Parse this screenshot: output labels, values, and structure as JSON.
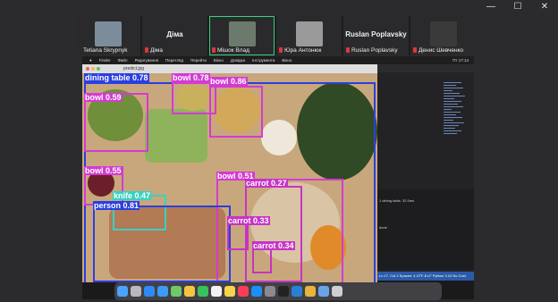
{
  "window_controls": {
    "minimize": "—",
    "maximize": "☐",
    "close": "✕"
  },
  "participants": [
    {
      "name": "Tetiana Skrypnyk",
      "has_video": true,
      "muted": false
    },
    {
      "name": "Діма",
      "has_video": false,
      "muted": true
    },
    {
      "name": "Мішок Влад",
      "has_video": true,
      "muted": true,
      "active_speaker": true
    },
    {
      "name": "Юра Антонюк",
      "has_video": true,
      "muted": true
    },
    {
      "name": "Ruslan Poplavsky",
      "has_video": false,
      "muted": true
    },
    {
      "name": "Денис Шевченко",
      "has_video": true,
      "muted": true
    }
  ],
  "mac_menubar": [
    "Finder",
    "Файл",
    "Редагування",
    "Перегляд",
    "Перейти",
    "Вікно",
    "Довідка",
    "Інструменти",
    "Вікно",
    "Довідка"
  ],
  "mac_status": "Пт 17:14",
  "preview": {
    "filename": "predict.jpg"
  },
  "detections": [
    {
      "label": "dining table 0.78",
      "color": "#2a3fe0"
    },
    {
      "label": "bowl 0.59",
      "color": "#d33bd3"
    },
    {
      "label": "bowl 0.78",
      "color": "#d33bd3"
    },
    {
      "label": "bowl 0.86",
      "color": "#d33bd3"
    },
    {
      "label": "bowl 0.55",
      "color": "#d33bd3"
    },
    {
      "label": "bowl 0.51",
      "color": "#d33bd3"
    },
    {
      "label": "carrot 0.27",
      "color": "#c733c7"
    },
    {
      "label": "knife 0.47",
      "color": "#3ad1c0"
    },
    {
      "label": "person 0.81",
      "color": "#2a3fe0"
    },
    {
      "label": "carrot 0.33",
      "color": "#c733c7"
    },
    {
      "label": "carrot 0.34",
      "color": "#c733c7"
    }
  ],
  "ide": {
    "console_line1": "1 dining table, 32.0ms",
    "console_line2": "done",
    "statusbar": "Ln 17, Col 2   Spaces: 4   UTF-8   LF   Python   3.10   No Cost"
  },
  "dock_apps": [
    "finder",
    "launchpad",
    "safari",
    "mail",
    "maps",
    "photos",
    "facetime",
    "calendar",
    "notes",
    "music",
    "app-store",
    "settings",
    "terminal",
    "vscode",
    "chrome",
    "preview",
    "trash"
  ]
}
